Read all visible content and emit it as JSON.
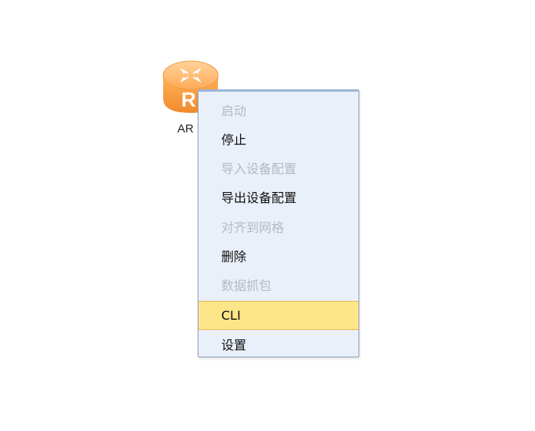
{
  "device": {
    "label": "AR",
    "icon": "router-icon",
    "colors": {
      "body": "#f59a3c",
      "top": "#ffc27a",
      "glyph": "#ffffff"
    }
  },
  "context_menu": {
    "items": [
      {
        "label": "启动",
        "enabled": false,
        "highlighted": false
      },
      {
        "label": "停止",
        "enabled": true,
        "highlighted": false
      },
      {
        "label": "导入设备配置",
        "enabled": false,
        "highlighted": false
      },
      {
        "label": "导出设备配置",
        "enabled": true,
        "highlighted": false
      },
      {
        "label": "对齐到网格",
        "enabled": false,
        "highlighted": false
      },
      {
        "label": "删除",
        "enabled": true,
        "highlighted": false
      },
      {
        "label": "数据抓包",
        "enabled": false,
        "highlighted": false
      },
      {
        "label": "CLI",
        "enabled": true,
        "highlighted": true
      },
      {
        "label": "设置",
        "enabled": true,
        "highlighted": false
      }
    ],
    "colors": {
      "background": "#eaf0f9",
      "highlight": "#fde68a",
      "disabled_text": "#b4b9c2"
    }
  }
}
